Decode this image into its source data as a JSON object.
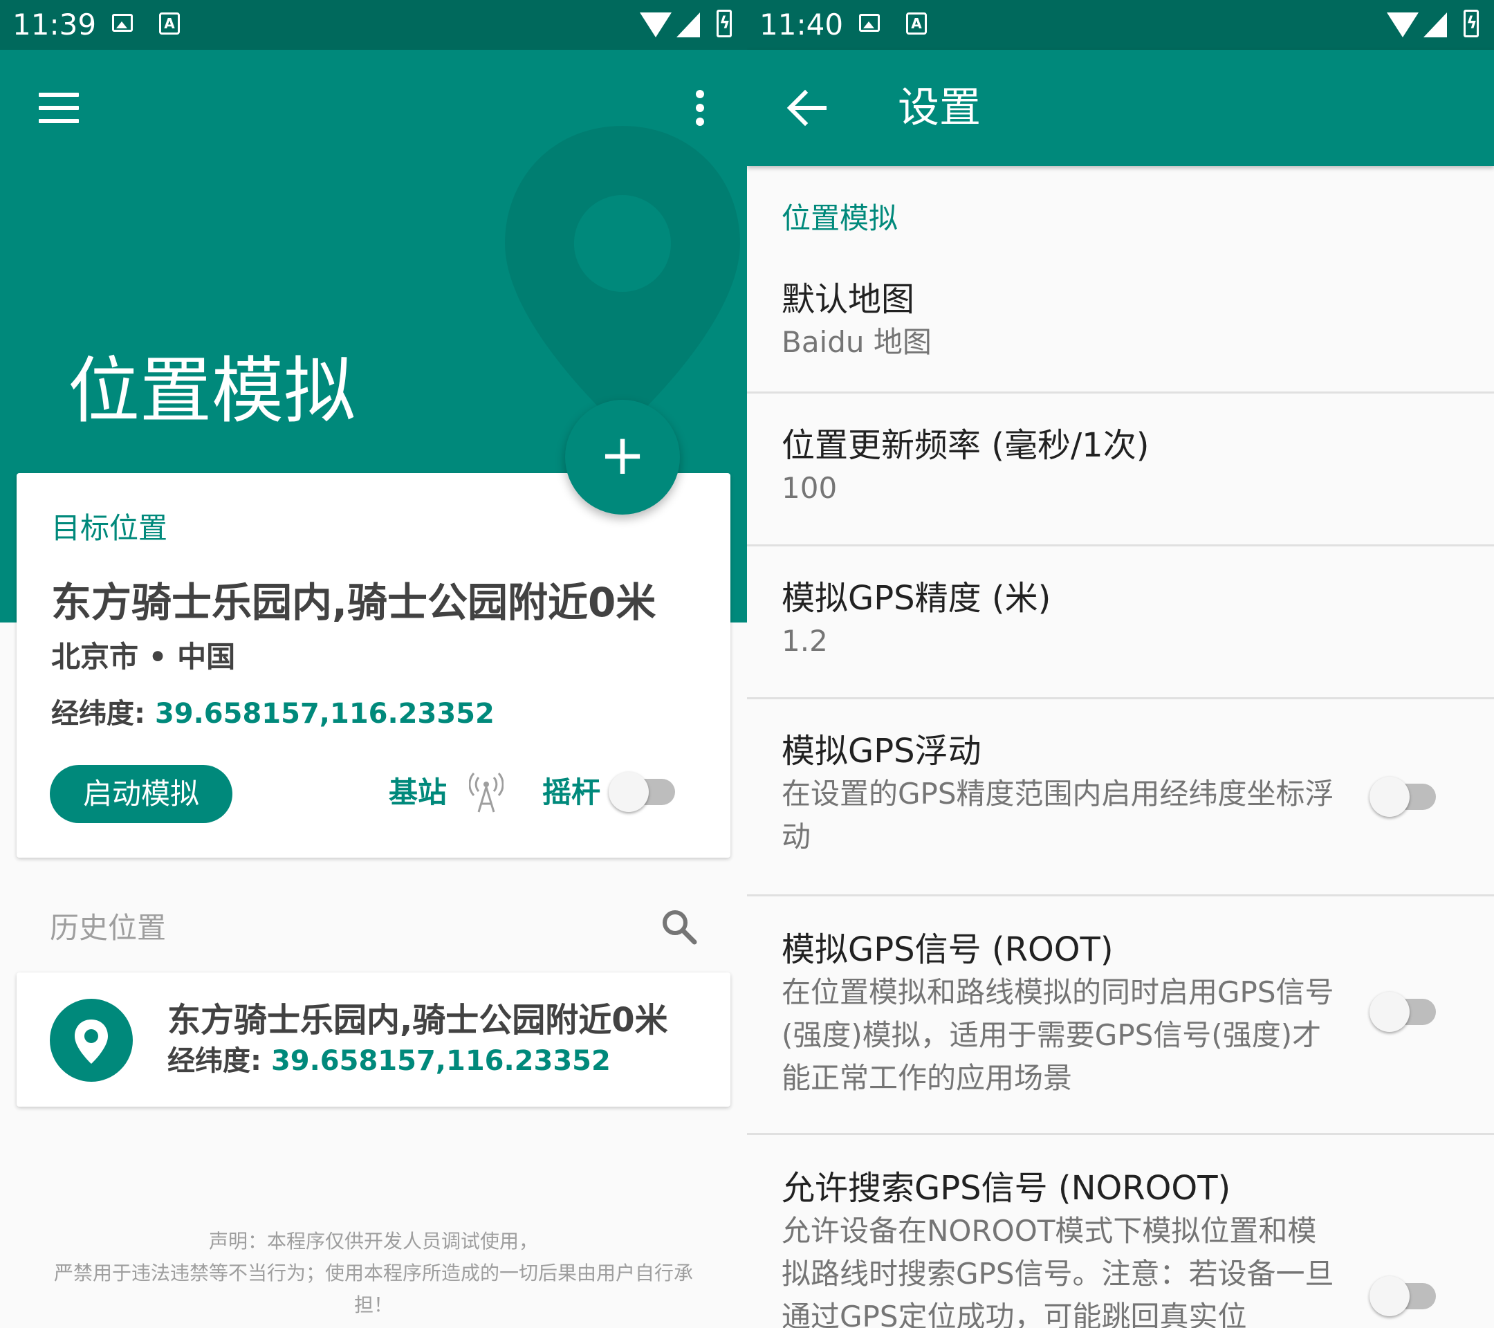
{
  "left_screen": {
    "status": {
      "time": "11:39"
    },
    "header": {
      "title": "位置模拟",
      "fab_label": "+"
    },
    "target_card": {
      "label": "目标位置",
      "place_name": "东方骑士乐园内,骑士公园附近0米",
      "region": "北京市 • 中国",
      "coords_label": "经纬度:",
      "coords_value": "39.658157,116.23352",
      "start_button": "启动模拟",
      "base_station_label": "基站",
      "joystick_label": "摇杆",
      "joystick_enabled": false
    },
    "history": {
      "title": "历史位置",
      "items": [
        {
          "name": "东方骑士乐园内,骑士公园附近0米",
          "coords_label": "经纬度:",
          "coords_value": "39.658157,116.23352"
        }
      ]
    },
    "disclaimer": {
      "line1": "声明：本程序仅供开发人员调试使用，",
      "line2": "严禁用于违法违禁等不当行为；使用本程序所造成的一切后果由用户自行承",
      "line3": "担！"
    }
  },
  "right_screen": {
    "status": {
      "time": "11:40"
    },
    "toolbar": {
      "title": "设置"
    },
    "section": "位置模拟",
    "prefs": [
      {
        "title": "默认地图",
        "summary": "Baidu 地图"
      },
      {
        "title": "位置更新频率 (毫秒/1次)",
        "summary": "100"
      },
      {
        "title": "模拟GPS精度 (米)",
        "summary": "1.2"
      },
      {
        "title": "模拟GPS浮动",
        "summary": "在设置的GPS精度范围内启用经纬度坐标浮动",
        "switch_on": false
      },
      {
        "title": "模拟GPS信号 (ROOT)",
        "summary": "在位置模拟和路线模拟的同时启用GPS信号(强度)模拟，适用于需要GPS信号(强度)才能正常工作的应用场景",
        "switch_on": false
      },
      {
        "title": "允许搜索GPS信号 (NOROOT)",
        "summary": "允许设备在NOROOT模式下模拟位置和模拟路线时搜索GPS信号。注意：若设备一旦通过GPS定位成功，可能跳回真实位",
        "switch_on": false
      }
    ]
  },
  "colors": {
    "primary": "#00897b",
    "status_bar": "#00695c",
    "background": "#fafafa",
    "card": "#ffffff"
  },
  "icons": [
    "menu-icon",
    "more-vert-icon",
    "add-icon",
    "antenna-icon",
    "search-icon",
    "location-pin-icon",
    "back-arrow-icon",
    "wifi-icon",
    "signal-icon",
    "battery-charging-icon",
    "image-notification-icon",
    "a-notification-icon"
  ]
}
